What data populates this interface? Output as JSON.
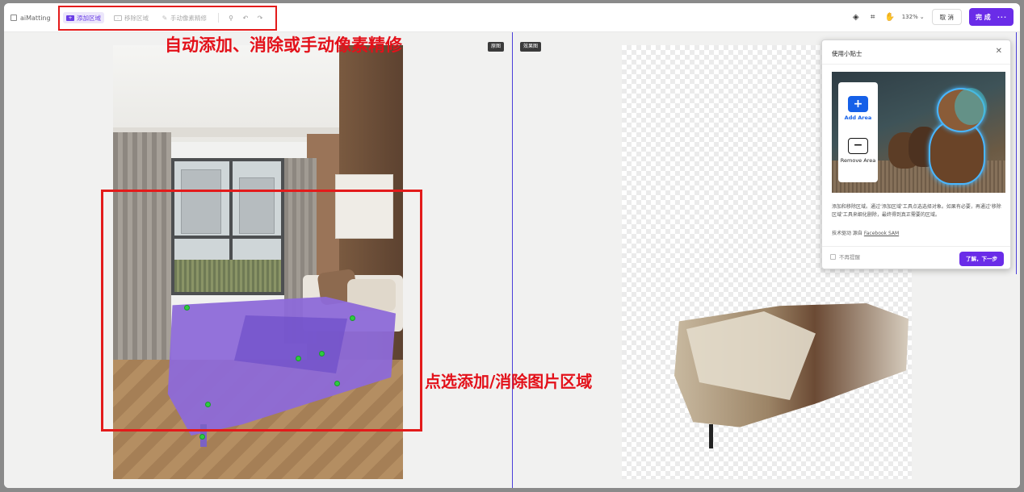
{
  "app": {
    "brand": "aiMatting"
  },
  "toolbar": {
    "add_area": "添加区域",
    "remove_area": "移除区域",
    "manual_refine": "手动像素精修",
    "zoom": "132%",
    "cancel": "取 消",
    "done": "完 成",
    "done_more": "···"
  },
  "canvas": {
    "original_tag": "原图",
    "result_tag": "效果图"
  },
  "annotations": {
    "top_caption": "自动添加、消除或手动像素精修",
    "mid_caption": "点选添加/消除图片区域"
  },
  "popup": {
    "title": "使用小贴士",
    "add_area": "Add Area",
    "remove_area": "Remove Area",
    "description": "添加和移除区域。通过‘添加区域’工具点选选择对象。如果有必要，再通过‘移除区域’工具来细化删除，最终得到真正需要的区域。",
    "tech_label": "技术驱动 源自",
    "tech_link": "Facebook SAM",
    "dont_remind": "不再提醒",
    "next": "了解，下一步"
  },
  "icons": {
    "undo": "undo-icon",
    "redo": "redo-icon",
    "magic": "magic-wand-icon",
    "fill": "paint-bucket-icon",
    "crop": "crop-icon",
    "hand": "hand-icon"
  },
  "colors": {
    "accent": "#6a2ce8",
    "annotation_red": "#e31b1b",
    "mask": "#8d6ad8",
    "point": "#2ecc40"
  }
}
